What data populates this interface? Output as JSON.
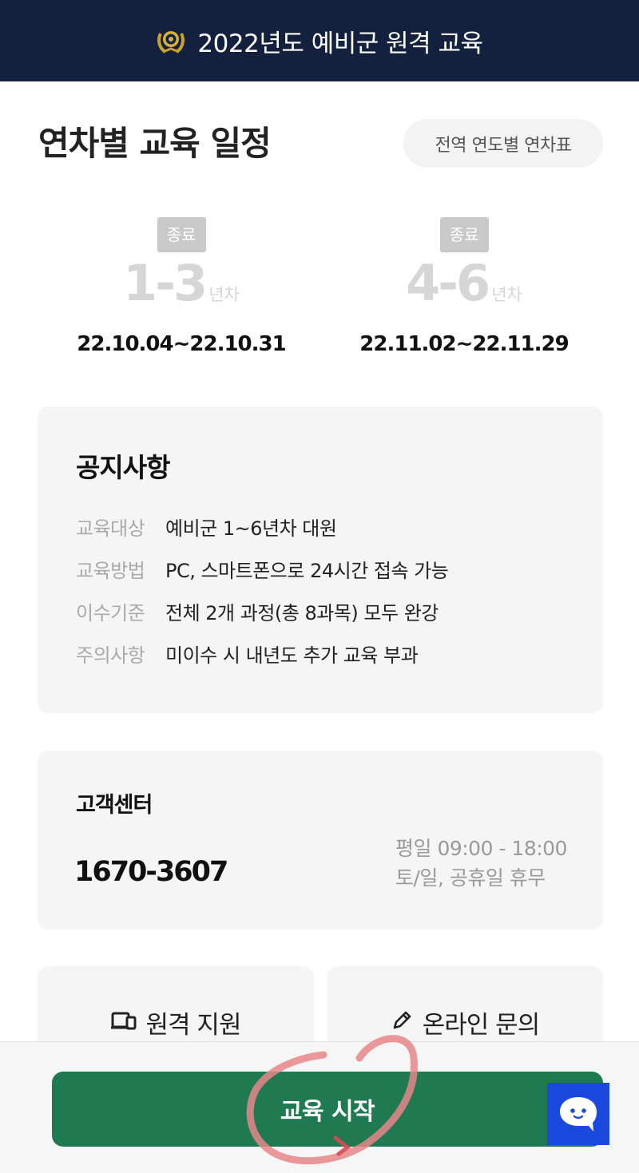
{
  "header": {
    "title": "2022년도 예비군 원격 교육",
    "emblem_icon": "army-emblem-icon"
  },
  "schedule": {
    "title": "연차별 교육 일정",
    "table_button": "전역 연도별 연차표",
    "items": [
      {
        "status": "종료",
        "years": "1-3",
        "unit": "년차",
        "dates": "22.10.04~22.10.31"
      },
      {
        "status": "종료",
        "years": "4-6",
        "unit": "년차",
        "dates": "22.11.02~22.11.29"
      }
    ]
  },
  "notice": {
    "title": "공지사항",
    "rows": [
      {
        "label": "교육대상",
        "value": "예비군 1~6년차 대원"
      },
      {
        "label": "교육방법",
        "value": "PC, 스마트폰으로 24시간 접속 가능"
      },
      {
        "label": "이수기준",
        "value": "전체 2개 과정(총 8과목) 모두 완강"
      },
      {
        "label": "주의사항",
        "value": "미이수 시 내년도 추가 교육 부과"
      }
    ]
  },
  "customer_center": {
    "title": "고객센터",
    "phone": "1670-3607",
    "hours_weekday": "평일 09:00 - 18:00",
    "hours_weekend": "토/일, 공휴일 휴무"
  },
  "help": {
    "remote_support": "원격 지원",
    "online_inquiry": "온라인 문의"
  },
  "bottom": {
    "start_button": "교육 시작"
  },
  "colors": {
    "header_bg": "#13213f",
    "start_button": "#1f7a52",
    "chat_button": "#1c49dd",
    "annotation": "#e8868a"
  }
}
